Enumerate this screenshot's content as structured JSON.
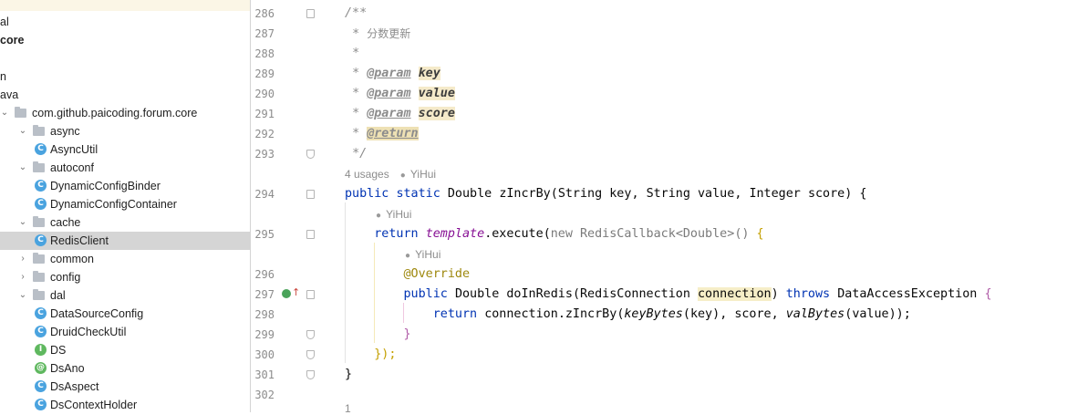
{
  "project_tree": {
    "items": [
      {
        "label": "al",
        "kind": "text",
        "depth": 0
      },
      {
        "label": "core",
        "kind": "bold",
        "depth": 0
      },
      {
        "label": "",
        "kind": "blank",
        "depth": 0
      },
      {
        "label": "n",
        "kind": "text",
        "depth": 0
      },
      {
        "label": "ava",
        "kind": "text",
        "depth": 0
      },
      {
        "label": "com.github.paicoding.forum.core",
        "kind": "package",
        "depth": 1
      },
      {
        "label": "async",
        "kind": "folder",
        "depth": 2
      },
      {
        "label": "AsyncUtil",
        "kind": "class",
        "depth": 3
      },
      {
        "label": "autoconf",
        "kind": "folder",
        "depth": 2
      },
      {
        "label": "DynamicConfigBinder",
        "kind": "class",
        "depth": 3
      },
      {
        "label": "DynamicConfigContainer",
        "kind": "class",
        "depth": 3
      },
      {
        "label": "cache",
        "kind": "folder",
        "depth": 2
      },
      {
        "label": "RedisClient",
        "kind": "class",
        "depth": 3,
        "selected": true
      },
      {
        "label": "common",
        "kind": "folder-collapsed",
        "depth": 2
      },
      {
        "label": "config",
        "kind": "folder-collapsed",
        "depth": 2
      },
      {
        "label": "dal",
        "kind": "folder",
        "depth": 2
      },
      {
        "label": "DataSourceConfig",
        "kind": "class",
        "depth": 3
      },
      {
        "label": "DruidCheckUtil",
        "kind": "class",
        "depth": 3
      },
      {
        "label": "DS",
        "kind": "interface",
        "depth": 3
      },
      {
        "label": "DsAno",
        "kind": "annotation",
        "depth": 3
      },
      {
        "label": "DsAspect",
        "kind": "class",
        "depth": 3
      },
      {
        "label": "DsContextHolder",
        "kind": "class",
        "depth": 3
      }
    ],
    "icon_glyphs": {
      "class": "C",
      "interface": "I",
      "annotation": "@"
    },
    "colors": {
      "class": "#4aa3df",
      "interface": "#5fb85f",
      "annotation": "#5fb85f",
      "selected": "#d5d5d5"
    }
  },
  "editor": {
    "line_numbers": [
      "286",
      "287",
      "288",
      "289",
      "290",
      "291",
      "292",
      "293",
      "294",
      "295",
      "296",
      "297",
      "298",
      "299",
      "300",
      "301",
      "302"
    ],
    "javadoc": {
      "open": "/**",
      "star": "*",
      "summary": "分数更新",
      "close": "*/",
      "param_tag": "@param",
      "return_tag": "@return",
      "params": [
        "key",
        "value",
        "score"
      ]
    },
    "hints": {
      "usages": "4 usages",
      "author": "YiHui"
    },
    "code": {
      "kw_public": "public",
      "kw_static": "static",
      "kw_return": "return",
      "kw_new": "new",
      "kw_throws": "throws",
      "t_double": "Double",
      "t_string": "String",
      "t_integer": "Integer",
      "m_zincr": "zIncrBy",
      "p_key": "key",
      "p_value": "value",
      "p_score": "score",
      "f_template": "template",
      "m_execute": ".execute",
      "t_redis_cb": "RedisCallback",
      "t_double_gen": "<Double>",
      "ann_override": "@Override",
      "m_doinredis": "doInRedis",
      "t_redis_conn": "RedisConnection",
      "p_connection": "connection",
      "t_dae": "DataAccessException",
      "v_connection": "connection",
      "m_zincr_call": ".zIncrBy",
      "m_keybytes": "keyBytes",
      "m_valbytes": "valBytes",
      "close_paren_brace": "});",
      "close_brace": "}",
      "open_brace": "{",
      "comma": ",",
      "lparen": "(",
      "rparen": ")",
      "rparen_semicolon": "));",
      "empty_parens": "()",
      "bottom_partial": "1"
    },
    "colors": {
      "keyword": "#0033b3",
      "comment": "#8c8c8c",
      "field": "#871094",
      "annotation": "#9e880d",
      "highlight": "#f6eec8"
    }
  }
}
